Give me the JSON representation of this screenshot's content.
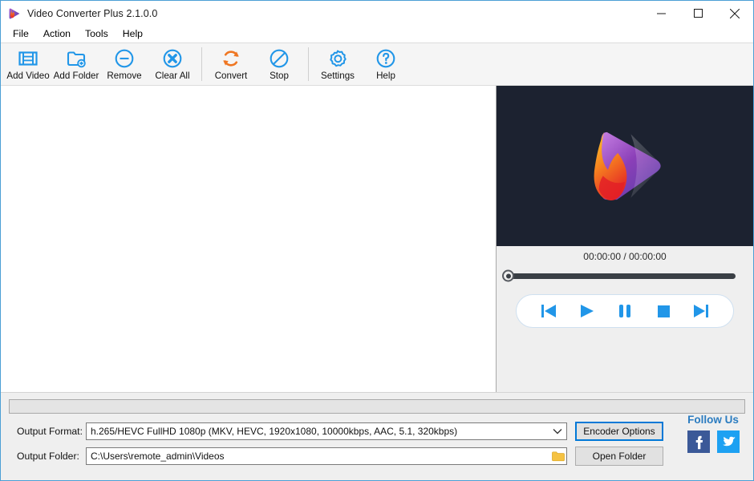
{
  "window": {
    "title": "Video Converter Plus 2.1.0.0",
    "app_icon": "play-flame-logo-icon",
    "minimize_label": "Minimize",
    "maximize_label": "Maximize",
    "close_label": "Close"
  },
  "menubar": {
    "items": [
      {
        "label": "File"
      },
      {
        "label": "Action"
      },
      {
        "label": "Tools"
      },
      {
        "label": "Help"
      }
    ]
  },
  "toolbar": {
    "buttons": [
      {
        "label": "Add Video",
        "icon": "film-strip-icon",
        "color": "#2196e8"
      },
      {
        "label": "Add Folder",
        "icon": "folder-add-icon",
        "color": "#2196e8"
      },
      {
        "label": "Remove",
        "icon": "minus-circle-icon",
        "color": "#2196e8"
      },
      {
        "label": "Clear All",
        "icon": "x-circle-icon",
        "color": "#2196e8"
      },
      {
        "label": "Convert",
        "icon": "refresh-arrows-icon",
        "color": "#ef7622"
      },
      {
        "label": "Stop",
        "icon": "no-entry-icon",
        "color": "#2196e8"
      },
      {
        "label": "Settings",
        "icon": "gear-icon",
        "color": "#2196e8"
      },
      {
        "label": "Help",
        "icon": "question-circle-icon",
        "color": "#2196e8"
      }
    ]
  },
  "filelist": {
    "items": [],
    "empty": ""
  },
  "preview": {
    "logo_icon": "play-flame-logo-icon",
    "background_color": "#1c2230",
    "time_display": "00:00:00 / 00:00:00",
    "seek_position_percent": 0,
    "controls": [
      {
        "label": "Previous",
        "icon": "skip-previous-icon"
      },
      {
        "label": "Play",
        "icon": "play-icon"
      },
      {
        "label": "Pause",
        "icon": "pause-icon"
      },
      {
        "label": "Stop",
        "icon": "stop-icon"
      },
      {
        "label": "Next",
        "icon": "skip-next-icon"
      }
    ]
  },
  "bottom": {
    "progress_percent": 0,
    "output_format": {
      "label": "Output Format:",
      "value": "h.265/HEVC FullHD 1080p (MKV, HEVC, 1920x1080, 10000kbps, AAC, 5.1, 320kbps)",
      "arrow_icon": "chevron-down-icon"
    },
    "output_folder": {
      "label": "Output Folder:",
      "value": "C:\\Users\\remote_admin\\Videos",
      "browse_icon": "folder-icon"
    },
    "encoder_options_label": "Encoder Options",
    "open_folder_label": "Open Folder",
    "follow": {
      "title": "Follow Us",
      "networks": [
        {
          "name": "facebook-icon",
          "color": "#3b5998"
        },
        {
          "name": "twitter-icon",
          "color": "#1da1f2"
        }
      ]
    }
  },
  "colors": {
    "accent_blue": "#2196e8",
    "orange": "#ef7622",
    "window_border": "#4b9fd5",
    "toolbar_bg": "#f5f5f5",
    "panel_bg": "#efefef"
  }
}
